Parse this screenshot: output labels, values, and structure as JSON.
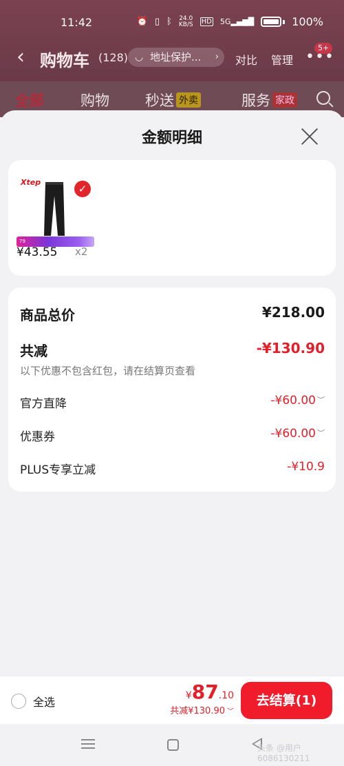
{
  "status_bar": {
    "time": "11:42",
    "net_speed_value": "24.0",
    "net_speed_unit": "KB/S",
    "hd": "HD",
    "signal": "5G",
    "battery_pct": "100%"
  },
  "header": {
    "back_icon": "chevron-left-icon",
    "title": "购物车",
    "count": "(128)",
    "address": "地址保护...",
    "compare": "对比",
    "manage": "管理",
    "more_badge": "5+"
  },
  "tabs": [
    {
      "label": "全部",
      "active": true
    },
    {
      "label": "购物",
      "active": false
    },
    {
      "label": "秒送",
      "tag": "外卖",
      "active": false
    },
    {
      "label": "服务",
      "tag": "家政",
      "active": false
    }
  ],
  "sheet": {
    "title": "金额明细",
    "product": {
      "brand": "Xtep",
      "price": "¥43.55",
      "qty": "x2",
      "promo_price": "79"
    },
    "details": {
      "total_label": "商品总价",
      "total_value": "¥218.00",
      "discount_label": "共减",
      "discount_value": "-¥130.90",
      "note": "以下优惠不包含红包，请在结算页查看",
      "items": [
        {
          "label": "官方直降",
          "value": "-¥60.00"
        },
        {
          "label": "优惠券",
          "value": "-¥60.00"
        },
        {
          "label": "PLUS专享立减",
          "value": "-¥10.9"
        }
      ]
    }
  },
  "bottom_bar": {
    "select_all": "全选",
    "currency": "¥",
    "amount_int": "87",
    "amount_dec": ".10",
    "discount": "共减¥130.90",
    "checkout": "去结算(1)"
  },
  "watermark": "头条 @用户6086130211",
  "colors": {
    "accent_red": "#e3202a",
    "checkout_red": "#f01c2c",
    "header_bg": "#6a3a48"
  }
}
